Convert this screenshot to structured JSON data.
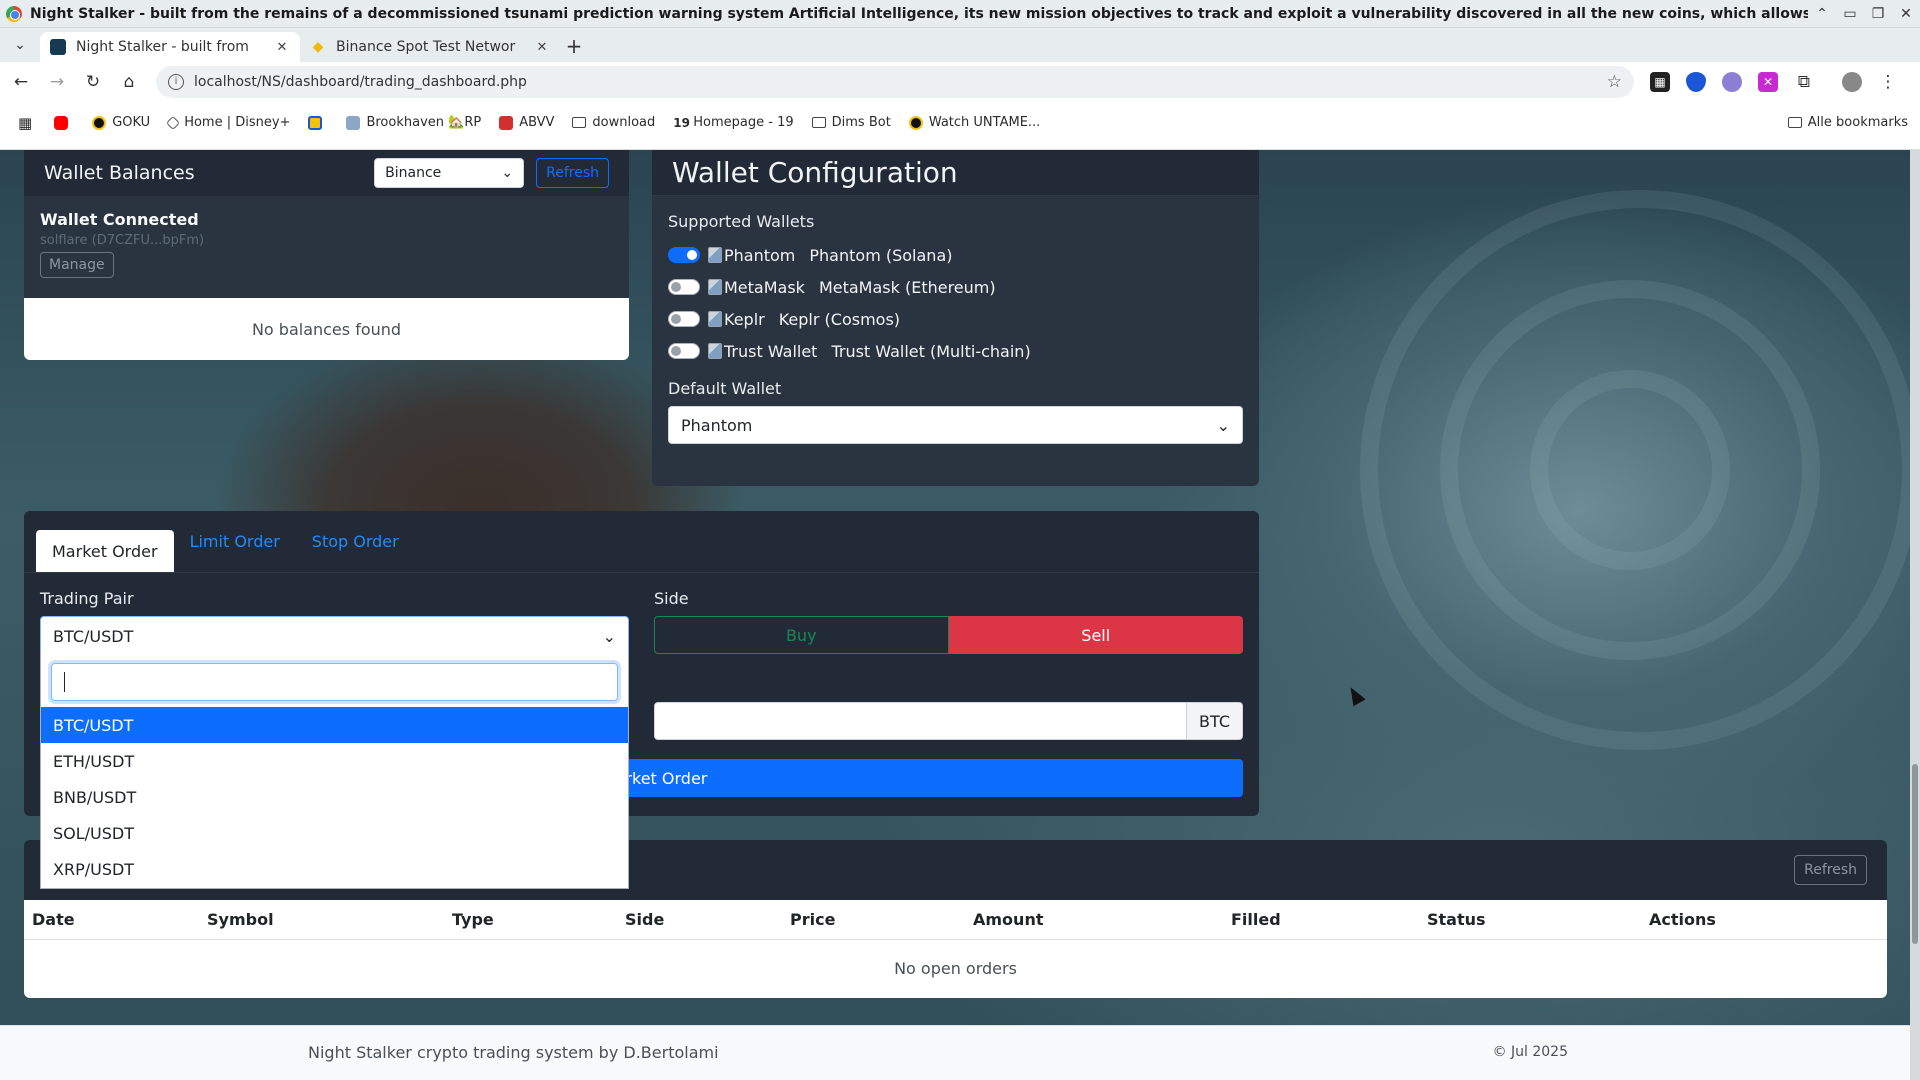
{
  "window": {
    "title": "Night Stalker - built from the remains of a decommissioned tsunami prediction warning system Artificial Intelligence, its new mission objectives to track and exploit a vulnerability discovered in all the new coins, which allows this system to predict and"
  },
  "tabs": [
    {
      "label": "Night Stalker - built from",
      "active": true
    },
    {
      "label": "Binance Spot Test Networ",
      "active": false
    }
  ],
  "address_bar": {
    "url": "localhost/NS/dashboard/trading_dashboard.php"
  },
  "bookmarks": {
    "items": [
      "GOKU",
      "Home | Disney+",
      "Brookhaven 🏡RP",
      "ABVV",
      "download",
      "Homepage - 19",
      "Dims Bot",
      "Watch UNTAME..."
    ],
    "all_label": "Alle bookmarks"
  },
  "wallet_balances": {
    "title": "Wallet Balances",
    "exchange_select": "Binance",
    "refresh_label": "Refresh",
    "connected_label": "Wallet Connected",
    "address": "solflare (D7CZFU...bpFm)",
    "manage_label": "Manage",
    "empty_text": "No balances found"
  },
  "wallet_config": {
    "title": "Wallet Configuration",
    "supported_label": "Supported Wallets",
    "wallets": [
      {
        "img_alt": "Phantom",
        "label": "Phantom (Solana)",
        "enabled": true
      },
      {
        "img_alt": "MetaMask",
        "label": "MetaMask (Ethereum)",
        "enabled": false
      },
      {
        "img_alt": "Keplr",
        "label": "Keplr (Cosmos)",
        "enabled": false
      },
      {
        "img_alt": "Trust Wallet",
        "label": "Trust Wallet (Multi-chain)",
        "enabled": false
      }
    ],
    "default_label": "Default Wallet",
    "default_value": "Phantom"
  },
  "order_form": {
    "tabs": [
      "Market Order",
      "Limit Order",
      "Stop Order"
    ],
    "active_tab": "Market Order",
    "pair_label": "Trading Pair",
    "pair_value": "BTC/USDT",
    "side_label": "Side",
    "buy_label": "Buy",
    "sell_label": "Sell",
    "amount_unit": "BTC",
    "submit_visible_text": "arket Order",
    "pair_options": [
      "BTC/USDT",
      "ETH/USDT",
      "BNB/USDT",
      "SOL/USDT",
      "XRP/USDT"
    ],
    "selected_option": "BTC/USDT"
  },
  "open_orders": {
    "refresh_label": "Refresh",
    "columns": [
      "Date",
      "Symbol",
      "Type",
      "Side",
      "Price",
      "Amount",
      "Filled",
      "Status",
      "Actions"
    ],
    "empty_text": "No open orders"
  },
  "footer": {
    "left": "Night Stalker crypto trading system by D.Bertolami",
    "right": "© Jul 2025"
  },
  "colors": {
    "primary": "#0d6efd",
    "danger": "#dc3545",
    "success": "#198754",
    "panel_dark": "#212a36"
  }
}
